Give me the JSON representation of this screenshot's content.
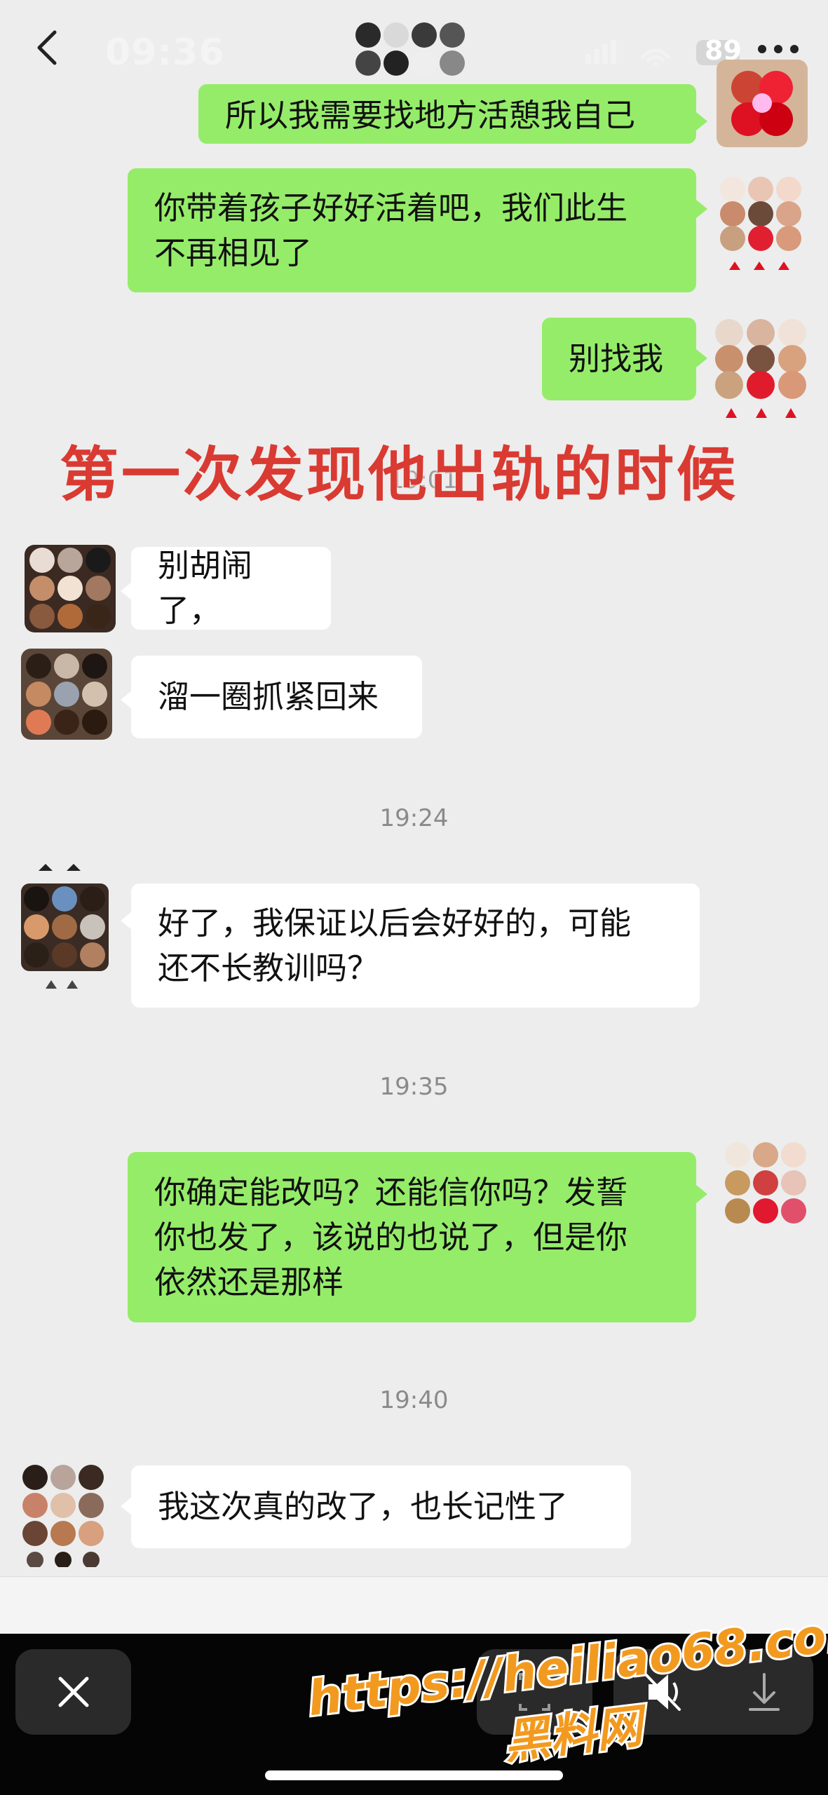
{
  "status_bar": {
    "time": "09:36",
    "battery": "89"
  },
  "messages": [
    {
      "side": "right",
      "text": "所以我需要找地方活憩我自己"
    },
    {
      "side": "right",
      "line1": "你带着孩子好好活着吧，我们此生",
      "line2": "不再相见了"
    },
    {
      "side": "right",
      "text": "别找我"
    },
    {
      "side": "left",
      "text": "别胡闹了，"
    },
    {
      "side": "left",
      "text": "溜一圈抓紧回来"
    },
    {
      "side": "left",
      "line1": "好了，我保证以后会好好的，可能",
      "line2": "还不长教训吗？"
    },
    {
      "side": "right",
      "line1": "你确定能改吗？还能信你吗？发誓",
      "line2": "你也发了，该说的也说了，但是你",
      "line3": "依然还是那样"
    },
    {
      "side": "left",
      "text": "我这次真的改了，也长记性了"
    }
  ],
  "timestamps": [
    "19:01",
    "19:24",
    "19:35",
    "19:40"
  ],
  "overlay_caption": "第一次发现他出轨的时候",
  "watermark": {
    "url": "https://heiliao68.com",
    "name": "黑料网"
  },
  "colors": {
    "chat_background": "#ededed",
    "sent_bubble": "#95ec69",
    "received_bubble": "#ffffff",
    "caption_red": "#d93a32",
    "watermark_orange": "#f29a1f"
  },
  "icons": [
    "back-chevron-icon",
    "signal-icon",
    "wifi-icon",
    "battery-icon",
    "more-icon",
    "close-icon",
    "scan-icon",
    "mute-icon",
    "download-icon"
  ]
}
